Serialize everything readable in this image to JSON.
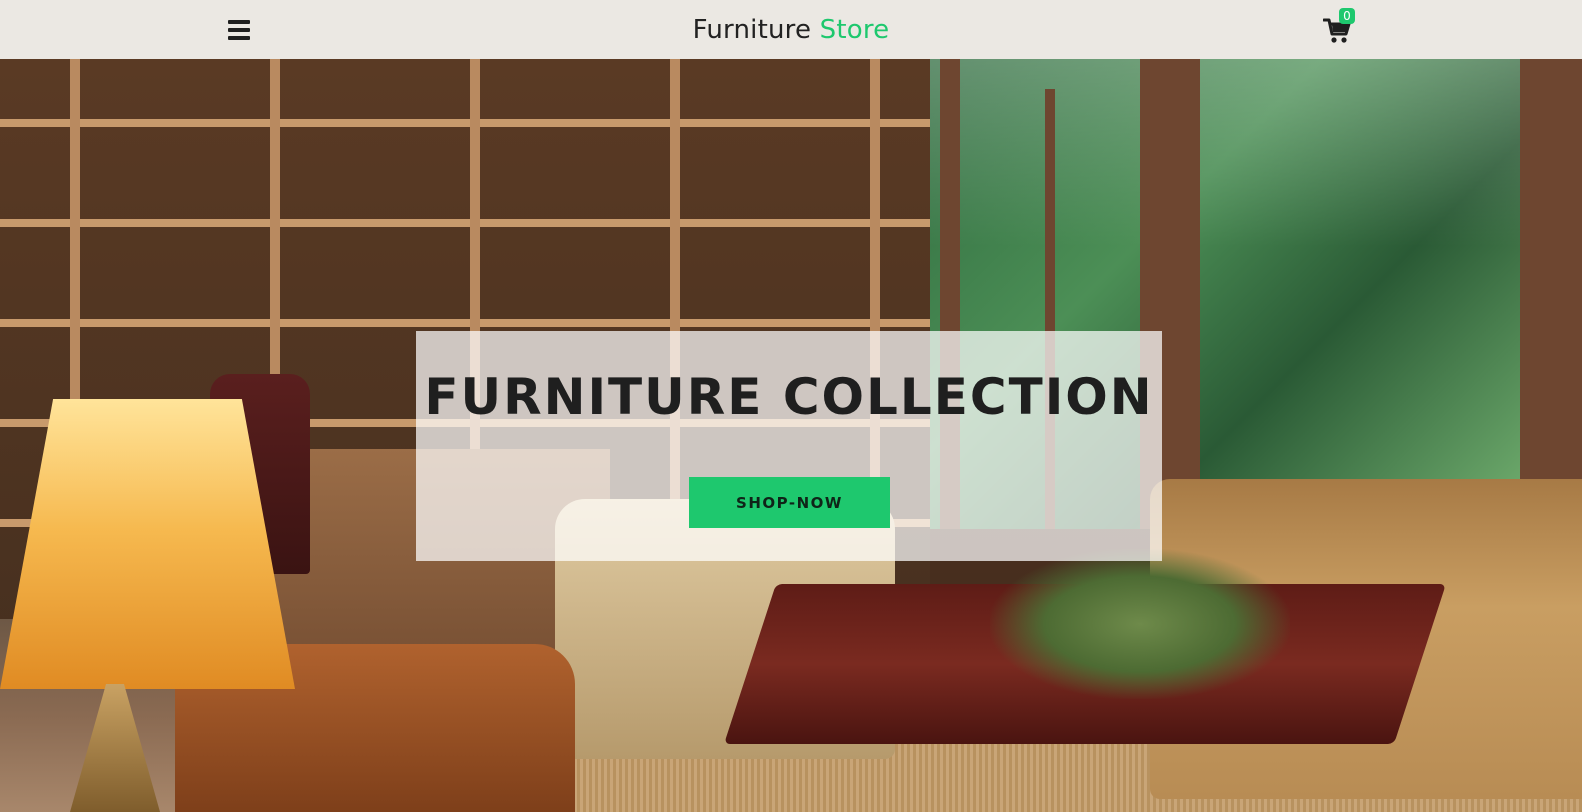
{
  "navbar": {
    "menu_icon": "hamburger-menu-icon",
    "brand_primary": "Furniture",
    "brand_accent": "Store",
    "cart_icon": "shopping-cart-icon",
    "cart_count": "0"
  },
  "hero": {
    "headline": "FURNITURE COLLECTION",
    "cta_label": "SHOP-NOW",
    "image": "living-room-furniture-photo"
  },
  "colors": {
    "accent": "#1ec86e",
    "navbar_bg": "#ebe8e3",
    "text_dark": "#1f1f1f"
  }
}
